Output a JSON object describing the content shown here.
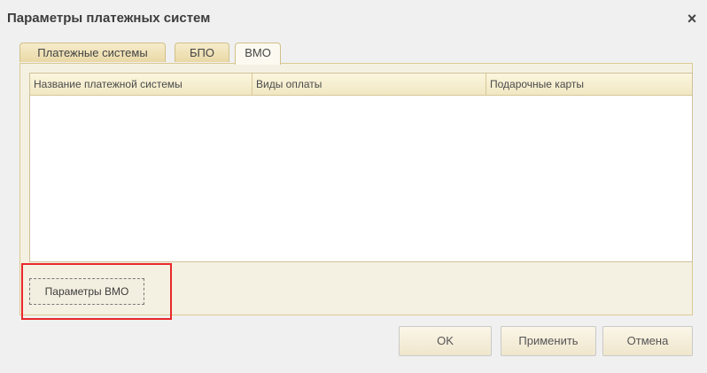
{
  "window": {
    "title": "Параметры платежных систем",
    "close_glyph": "×"
  },
  "tabs": [
    {
      "label": "Платежные системы",
      "active": false
    },
    {
      "label": "БПО",
      "active": false
    },
    {
      "label": "ВМО",
      "active": true
    }
  ],
  "table": {
    "columns": [
      "Название платежной системы",
      "Виды оплаты",
      "Подарочные карты"
    ],
    "rows": []
  },
  "panel": {
    "vmo_params_label": "Параметры ВМО"
  },
  "footer": {
    "ok_label": "OK",
    "apply_label": "Применить",
    "cancel_label": "Отмена"
  },
  "colors": {
    "highlight": "#e8282b",
    "tab_bg": "#ead9a6",
    "header_bg": "#f1e7c2"
  }
}
